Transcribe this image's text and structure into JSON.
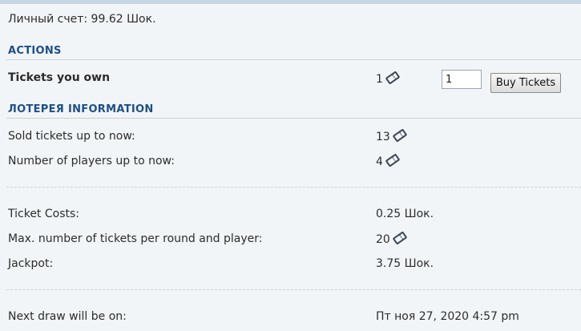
{
  "account": {
    "balance_text": "Личный счет: 99.62 Шок."
  },
  "actions": {
    "title": "ACTIONS",
    "tickets_owned_label": "Tickets you own",
    "tickets_owned_value": "1",
    "quantity_value": "1",
    "buy_button_label": "Buy Tickets"
  },
  "info": {
    "title": "ЛОТЕРЕЯ INFORMATION",
    "sold_tickets_label": "Sold tickets up to now:",
    "sold_tickets_value": "13",
    "players_label": "Number of players up to now:",
    "players_value": "4"
  },
  "costs": {
    "ticket_cost_label": "Ticket Costs:",
    "ticket_cost_value": "0.25 Шок.",
    "max_tickets_label": "Max. number of tickets per round and player:",
    "max_tickets_value": "20",
    "jackpot_label": "Jackpot:",
    "jackpot_value": "3.75 Шок."
  },
  "draw": {
    "next_draw_label": "Next draw will be on:",
    "next_draw_value": "Пт ноя 27, 2020 4:57 pm"
  },
  "icons": {
    "ticket": "ticket-icon",
    "ticket_color": "#3b4654"
  }
}
